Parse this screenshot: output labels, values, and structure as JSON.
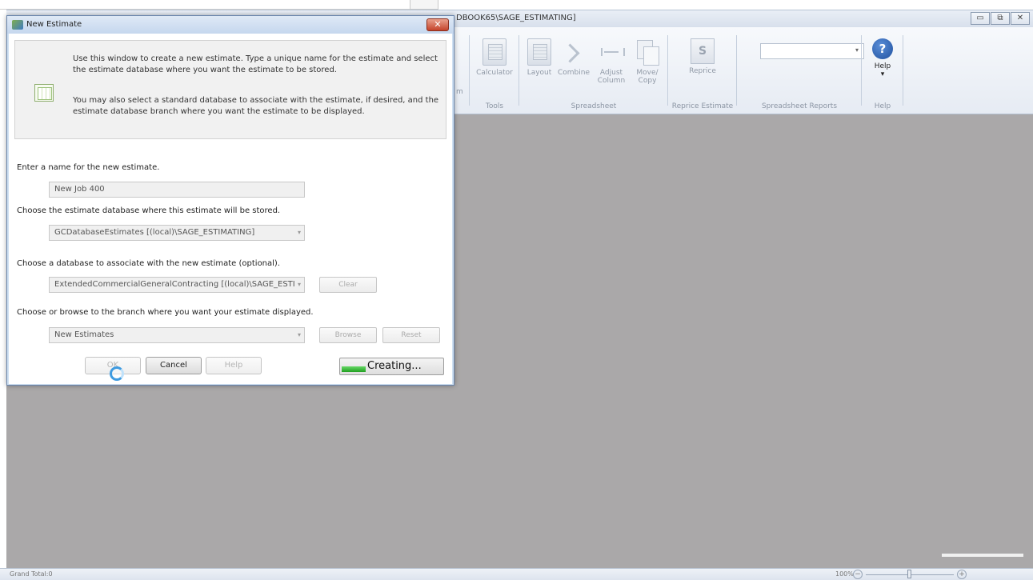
{
  "app": {
    "title": "DBOOK65\\SAGE_ESTIMATING]",
    "window_buttons": [
      "▭",
      "⧉",
      "✕"
    ],
    "ribbon": {
      "truncated_label": "m",
      "groups": [
        {
          "label": "Tools",
          "buttons": [
            "Calculator"
          ]
        },
        {
          "label": "Spreadsheet",
          "buttons": [
            "Layout",
            "Combine",
            "Adjust Column",
            "Move/ Copy"
          ]
        },
        {
          "label": "Reprice Estimate",
          "buttons": [
            "Reprice"
          ]
        },
        {
          "label": "Spreadsheet Reports",
          "combo_value": "",
          "combo_arrow": "▾"
        },
        {
          "label": "Help",
          "buttons": [
            "Help"
          ],
          "help_glyph": "?",
          "help_arrow": "▾"
        }
      ]
    },
    "status": {
      "left_text": "Grand Total:0",
      "zoom_level": "100%",
      "zoom_minus": "−",
      "zoom_plus": "+",
      "zoom_fraction": 0.5
    }
  },
  "dialog": {
    "title": "New Estimate",
    "close_glyph": "✕",
    "info_text_1": "Use this window to create a new estimate. Type a unique name for the estimate and select the estimate database where you want the estimate to be stored.",
    "info_text_2": "You may also select a standard database to associate with the estimate, if desired, and the estimate database branch where you want the estimate to be displayed.",
    "name_label": "Enter a name for the new estimate.",
    "name_value": "New Job 400",
    "db_label": "Choose the estimate database where this estimate will be stored.",
    "db_value": "GCDatabaseEstimates [(local)\\SAGE_ESTIMATING]",
    "assoc_label": "Choose a database to associate with the new estimate (optional).",
    "assoc_value": "ExtendedCommercialGeneralContracting [(local)\\SAGE_ESTI",
    "clear_label": "Clear",
    "branch_label": "Choose or browse to the branch where you want your estimate displayed.",
    "branch_value": "New Estimates",
    "browse_label": "Browse",
    "reset_label": "Reset",
    "ok_label": "OK",
    "cancel_label": "Cancel",
    "help_label": "Help",
    "progress_text": "Creating...",
    "progress_fraction": 0.24,
    "combo_arrow": "▾"
  },
  "colors": {
    "workspace": "#aaa8a9",
    "dialog_frame": "#cfe0f2",
    "progress_green": "#22a022",
    "close_red": "#c4432a"
  }
}
